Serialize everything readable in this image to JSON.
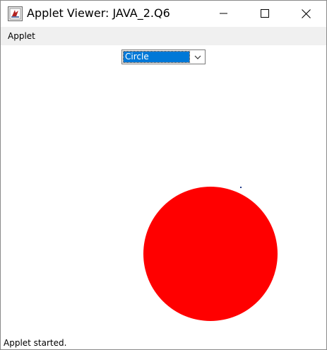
{
  "window": {
    "title": "Applet Viewer: JAVA_2.Q6",
    "app_icon": "java-applet-icon",
    "controls": {
      "minimize_icon": "minimize-icon",
      "maximize_icon": "maximize-icon",
      "close_icon": "close-icon"
    }
  },
  "menubar": {
    "items": [
      {
        "label": "Applet"
      }
    ]
  },
  "applet": {
    "shape_choice": {
      "selected": "Circle",
      "arrow_icon": "chevron-down-icon"
    },
    "drawing": {
      "shape": "circle",
      "fill_color": "#ff0000",
      "background_color": "#ffffff"
    }
  },
  "status": {
    "text": "Applet started."
  }
}
